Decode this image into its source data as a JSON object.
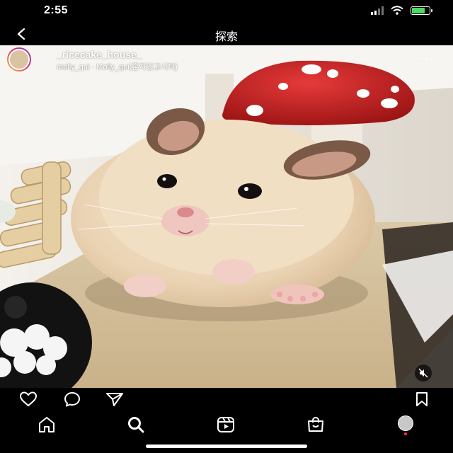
{
  "status_bar": {
    "time": "2:55",
    "battery_level": 0.75,
    "battery_color": "#4cd964",
    "icons": [
      "signal-icon",
      "wifi-icon",
      "battery-charging-icon"
    ]
  },
  "nav": {
    "title": "探索",
    "back_icon": "chevron-left-icon"
  },
  "post": {
    "username": "_ricecake_house_",
    "subtext": "molly_qui · Molly_qui(혼자있고시퍼)",
    "more_icon": "more-horizontal-icon",
    "more_label": "···",
    "media_description": "Hamster video",
    "mute_icon": "speaker-muted-icon"
  },
  "actions": {
    "icons": [
      "heart-icon",
      "comment-icon",
      "share-icon",
      "bookmark-icon"
    ]
  },
  "tab_bar": {
    "icons": [
      "home-icon",
      "search-icon",
      "reels-icon",
      "shop-icon",
      "profile-avatar"
    ],
    "active": "search-icon",
    "notification_color": "#ff3040"
  }
}
